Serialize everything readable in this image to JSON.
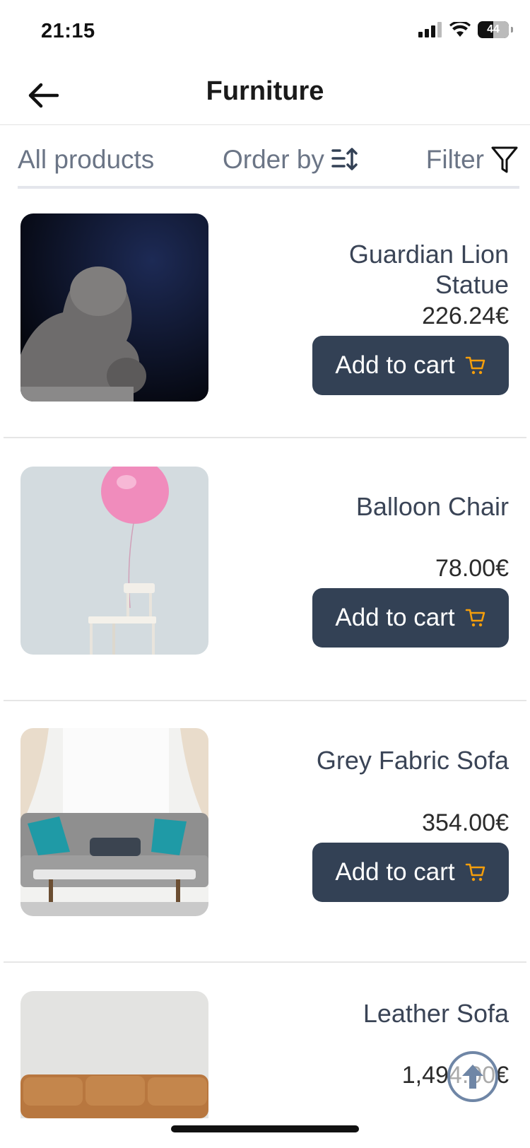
{
  "status": {
    "time": "21:15",
    "battery": "44"
  },
  "header": {
    "title": "Furniture"
  },
  "tabs": {
    "all": "All products",
    "order": "Order by",
    "filter": "Filter"
  },
  "products": [
    {
      "name": "Guardian Lion Statue",
      "price": "226.24€",
      "button": "Add to cart"
    },
    {
      "name": "Balloon Chair",
      "price": "78.00€",
      "button": "Add to cart"
    },
    {
      "name": "Grey Fabric Sofa",
      "price": "354.00€",
      "button": "Add to cart"
    },
    {
      "name": "Leather Sofa",
      "price": "1,494.00€"
    }
  ],
  "colors": {
    "button_bg": "#334155",
    "cart_icon": "#f59e0b",
    "tab_text": "#6b7586",
    "scroll_button": "#6f86a6"
  }
}
